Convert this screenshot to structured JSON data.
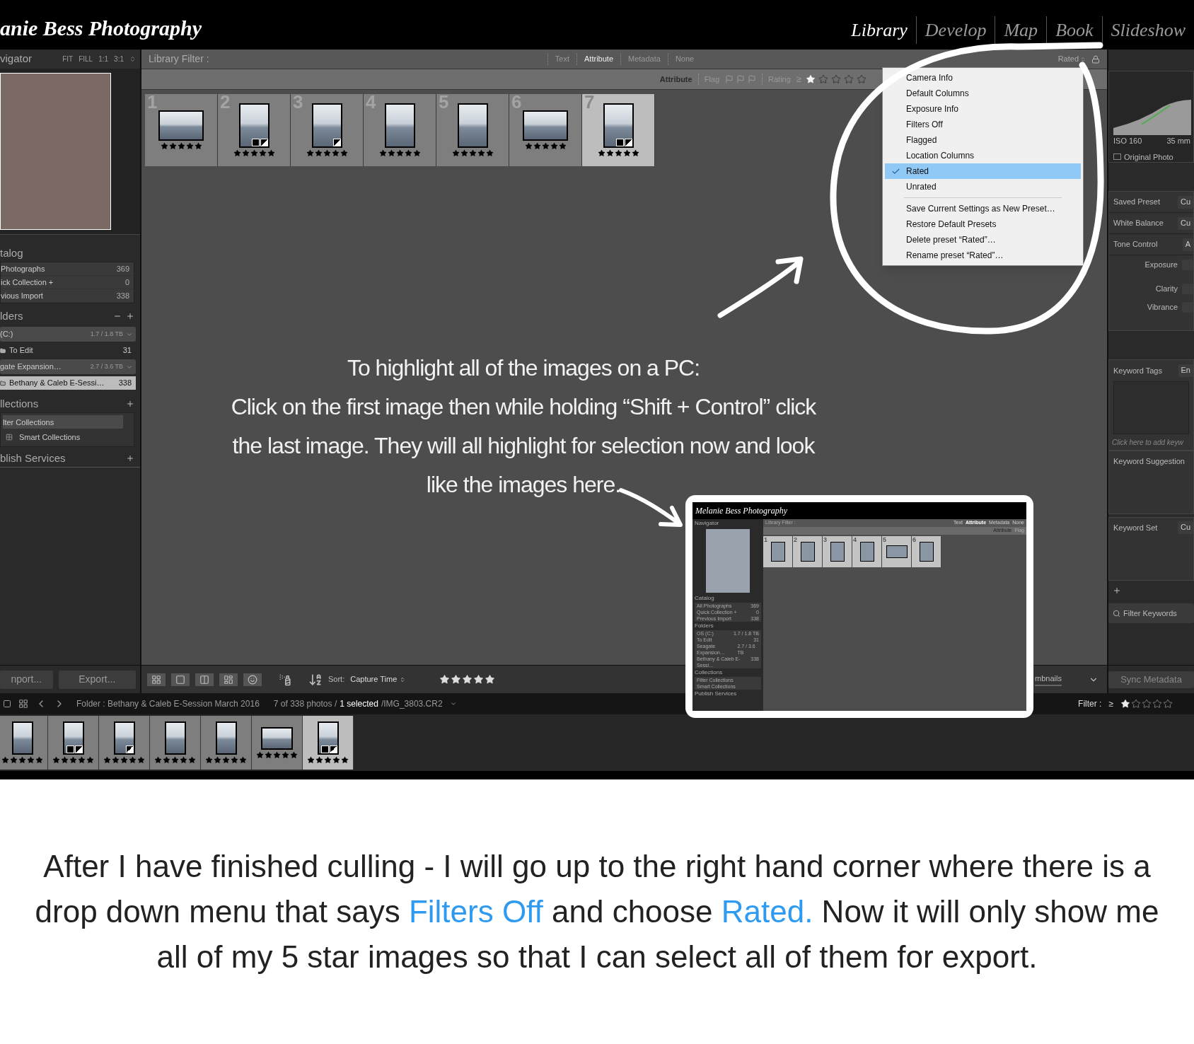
{
  "header": {
    "logo": "anie Bess Photography",
    "modules": [
      {
        "label": "Library",
        "selected": true
      },
      {
        "label": "Develop",
        "selected": false
      },
      {
        "label": "Map",
        "selected": false
      },
      {
        "label": "Book",
        "selected": false
      },
      {
        "label": "Slideshow",
        "selected": false
      }
    ]
  },
  "left_panel": {
    "navigator": {
      "title": "vigator",
      "zoom_options": [
        "FIT",
        "FILL",
        "1:1",
        "3:1"
      ]
    },
    "catalog": {
      "title": "talog",
      "rows": [
        {
          "label": "Photographs",
          "count": "369"
        },
        {
          "label": "ick Collection +",
          "count": "0"
        },
        {
          "label": "vious Import",
          "count": "338"
        }
      ]
    },
    "folders": {
      "title": "lders",
      "rows": [
        {
          "kind": "volume",
          "label": "(C:)",
          "count": "1.7 / 1.8 TB",
          "selected": false
        },
        {
          "kind": "folder",
          "label": "To Edit",
          "count": "31",
          "selected": false
        },
        {
          "kind": "volume",
          "label": "gate Expansion…",
          "count": "2.7 / 3.6 TB",
          "selected": false
        },
        {
          "kind": "folder",
          "label": "Bethany & Caleb E-Sessi…",
          "count": "338",
          "selected": true
        }
      ]
    },
    "collections": {
      "title": "llections",
      "placeholder": "lter Collections",
      "rows": [
        {
          "label": "Smart Collections"
        }
      ]
    },
    "publish_services": {
      "title": "blish Services"
    },
    "buttons": [
      "nport...",
      "Export..."
    ]
  },
  "filter_bar": {
    "title": "Library Filter :",
    "tabs": [
      {
        "label": "Text",
        "selected": false
      },
      {
        "label": "Attribute",
        "selected": true
      },
      {
        "label": "Metadata",
        "selected": false
      },
      {
        "label": "None",
        "selected": false
      }
    ],
    "preset": "Rated"
  },
  "attribute_bar": {
    "title": "Attribute",
    "flag_label": "Flag",
    "rating_label": "Rating",
    "operator": "≥",
    "stars": 1
  },
  "grid": {
    "cells": [
      {
        "number": "1",
        "kind": "landscape",
        "cropped": false,
        "adjusted": false,
        "stars": 5,
        "selected": false
      },
      {
        "number": "2",
        "kind": "portrait",
        "cropped": true,
        "adjusted": true,
        "stars": 5,
        "selected": false
      },
      {
        "number": "3",
        "kind": "portrait",
        "cropped": false,
        "adjusted": true,
        "stars": 5,
        "selected": false
      },
      {
        "number": "4",
        "kind": "portrait",
        "cropped": false,
        "adjusted": false,
        "stars": 5,
        "selected": false
      },
      {
        "number": "5",
        "kind": "portrait",
        "cropped": false,
        "adjusted": false,
        "stars": 5,
        "selected": false
      },
      {
        "number": "6",
        "kind": "landscape",
        "cropped": false,
        "adjusted": false,
        "stars": 5,
        "selected": false
      },
      {
        "number": "7",
        "kind": "portrait",
        "cropped": true,
        "adjusted": true,
        "stars": 5,
        "selected": true
      }
    ]
  },
  "dropdown_menu": {
    "items": [
      {
        "label": "Camera Info",
        "selected": false
      },
      {
        "label": "Default Columns",
        "selected": false
      },
      {
        "label": "Exposure Info",
        "selected": false
      },
      {
        "label": "Filters Off",
        "selected": false
      },
      {
        "label": "Flagged",
        "selected": false
      },
      {
        "label": "Location Columns",
        "selected": false
      },
      {
        "label": "Rated",
        "selected": true
      },
      {
        "label": "Unrated",
        "selected": false
      }
    ],
    "actions": [
      "Save Current Settings as New Preset…",
      "Restore Default Presets",
      "Delete preset “Rated”…",
      "Rename preset “Rated”…"
    ]
  },
  "right_panel": {
    "iso": "ISO 160",
    "focal_length": "35 mm",
    "original_photo": {
      "label": "Original Photo",
      "checked": false
    },
    "quick_develop": [
      {
        "label": "Saved Preset",
        "value": "Cu"
      },
      {
        "label": "White Balance",
        "value": "Cu"
      },
      {
        "label": "Tone Control",
        "value": "A"
      }
    ],
    "adjustments": [
      "Exposure",
      "Clarity",
      "Vibrance"
    ],
    "keyword_tags": {
      "label": "Keyword Tags",
      "value": "En",
      "placeholder": "Click here to add keyw"
    },
    "keyword_suggestions": "Keyword Suggestion",
    "keyword_set": {
      "label": "Keyword Set",
      "value": "Cu"
    },
    "filter_keywords": "Filter Keywords",
    "sync_button": "Sync Metadata"
  },
  "toolbar": {
    "sort_label": "Sort:",
    "sort_value": "Capture Time",
    "stars": 5,
    "thumbnails_label": "mbnails"
  },
  "status_bar": {
    "folder": "Folder : Bethany & Caleb E-Session March 2016",
    "count": "7 of 338 photos /",
    "selected": "1 selected",
    "file": "/IMG_3803.CR2",
    "filter_label": "Filter :",
    "operator": "≥",
    "stars": 1
  },
  "filmstrip": {
    "cells": [
      {
        "kind": "portrait",
        "cropped": false,
        "adjusted": false,
        "stars": 5,
        "selected": false
      },
      {
        "kind": "portrait",
        "cropped": true,
        "adjusted": true,
        "stars": 5,
        "selected": false
      },
      {
        "kind": "portrait",
        "cropped": false,
        "adjusted": true,
        "stars": 5,
        "selected": false
      },
      {
        "kind": "portrait",
        "cropped": false,
        "adjusted": false,
        "stars": 5,
        "selected": false
      },
      {
        "kind": "portrait",
        "cropped": false,
        "adjusted": false,
        "stars": 5,
        "selected": false
      },
      {
        "kind": "landscape",
        "cropped": false,
        "adjusted": false,
        "stars": 5,
        "selected": false
      },
      {
        "kind": "portrait",
        "cropped": true,
        "adjusted": true,
        "stars": 5,
        "selected": true
      }
    ]
  },
  "instruction": [
    "To highlight all of the images on a PC:",
    "Click on the first image then while holding “Shift + Control” click",
    "the last image.  They will all highlight for selection now and look",
    "like the images here."
  ],
  "inset": {
    "logo": "Melanie Bess Photography",
    "filter_title": "Library Filter :",
    "filter_tabs": [
      {
        "label": "Text",
        "selected": false
      },
      {
        "label": "Attribute",
        "selected": true
      },
      {
        "label": "Metadata",
        "selected": false
      },
      {
        "label": "None",
        "selected": false
      }
    ],
    "attribute": "Attribute",
    "flag": "Flag",
    "panels": [
      {
        "title": "Navigator"
      },
      {
        "title": "Catalog",
        "rows": [
          {
            "label": "All Photographs",
            "count": "369"
          },
          {
            "label": "Quick Collection +",
            "count": "0"
          },
          {
            "label": "Previous Import",
            "count": "338"
          }
        ]
      },
      {
        "title": "Folders",
        "rows": [
          {
            "label": "OS (C:)",
            "count": "1.7 / 1.8 TB"
          },
          {
            "label": "To Edit",
            "count": "31"
          },
          {
            "label": "Seagate Expansion…",
            "count": "2.7 / 3.6 TB"
          },
          {
            "label": "Bethany & Caleb E-Sessi…",
            "count": "338"
          }
        ]
      },
      {
        "title": "Collections",
        "rows": [
          {
            "label": "Filter Collections"
          },
          {
            "label": "Smart Collections"
          }
        ]
      },
      {
        "title": "Publish Services"
      }
    ],
    "cells": [
      {
        "number": "1",
        "kind": "portrait",
        "selected": true
      },
      {
        "number": "2",
        "kind": "portrait",
        "selected": true
      },
      {
        "number": "3",
        "kind": "portrait",
        "selected": true
      },
      {
        "number": "4",
        "kind": "portrait",
        "selected": true
      },
      {
        "number": "5",
        "kind": "landscape",
        "selected": true
      },
      {
        "number": "6",
        "kind": "portrait",
        "selected": true
      }
    ]
  },
  "caption": [
    {
      "text": "After I have finished culling - I will go up to the right hand corner where there is a drop down menu that says ",
      "highlight": false
    },
    {
      "text": "Filters Off",
      "highlight": true
    },
    {
      "text": " and choose ",
      "highlight": false
    },
    {
      "text": "Rated.",
      "highlight": true
    },
    {
      "text": " Now it will only show me all of my 5 star images so that I can select all of them for export.",
      "highlight": false
    }
  ]
}
